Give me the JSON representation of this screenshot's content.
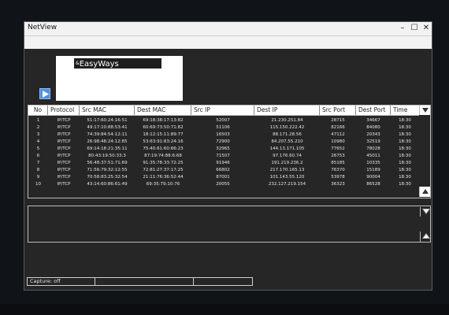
{
  "window": {
    "title": "NetView",
    "minimize_glyph": "–",
    "maximize_glyph": "☐",
    "close_glyph": "✕"
  },
  "logo": {
    "text": "EasyWays",
    "prefix": "&"
  },
  "table": {
    "columns": [
      "No",
      "Protocol",
      "Src MAC",
      "Dest MAC",
      "Src IP",
      "Dest IP",
      "Src Port",
      "Dest Port",
      "Time"
    ],
    "rows": [
      [
        "1",
        "IP/TCP",
        "51:17:60:24:16:51",
        "69:18:38:17:13:82",
        "52007",
        "21.230.251.84",
        "28715",
        "34667",
        "18:30"
      ],
      [
        "2",
        "IP/TCP",
        "49:17:10:88:53:41",
        "60:69:73:50:71:82",
        "51106",
        "115.150.222.42",
        "82166",
        "84080",
        "18:30"
      ],
      [
        "3",
        "IP/TCP",
        "74:39:84:54:12:11",
        "18:12:15:11:89:77",
        "16503",
        "88.171.28.56",
        "47112",
        "20343",
        "18:30"
      ],
      [
        "4",
        "IP/TCP",
        "26:98:48:24:12:85",
        "53:63:91:83:24:16",
        "72900",
        "84.207.55.210",
        "10980",
        "32519",
        "18:30"
      ],
      [
        "5",
        "IP/TCP",
        "69:14:18:21:35:11",
        "75:40:61:60:66:23",
        "32965",
        "144.13.171.105",
        "77652",
        "78028",
        "18:30"
      ],
      [
        "6",
        "IP/TCP",
        "80:43:19:50:33:3",
        "87:19:74:88:6:68",
        "71507",
        "97.176.60.74",
        "26753",
        "45011",
        "18:30"
      ],
      [
        "7",
        "IP/TCP",
        "56:48:37:51:71:69",
        "91:35:78:33:72:25",
        "91946",
        "191.219.236.2",
        "85185",
        "10335",
        "18:30"
      ],
      [
        "8",
        "IP/TCP",
        "71:56:79:32:12:55",
        "72:81:27:37:17:25",
        "66802",
        "217.170.165.13",
        "76370",
        "15189",
        "18:30"
      ],
      [
        "9",
        "IP/TCP",
        "70:58:83:25:32:54",
        "21:11:76:36:52:44",
        "87001",
        "101.143.55.120",
        "53978",
        "90004",
        "18:30"
      ],
      [
        "10",
        "IP/TCP",
        "43:14:60:86:61:49",
        "69:35:79:10:76",
        "20055",
        "232.127.219.154",
        "36323",
        "86528",
        "18:30"
      ]
    ]
  },
  "status": {
    "capture": "Capture: off",
    "cell2": "",
    "cell3": ""
  }
}
